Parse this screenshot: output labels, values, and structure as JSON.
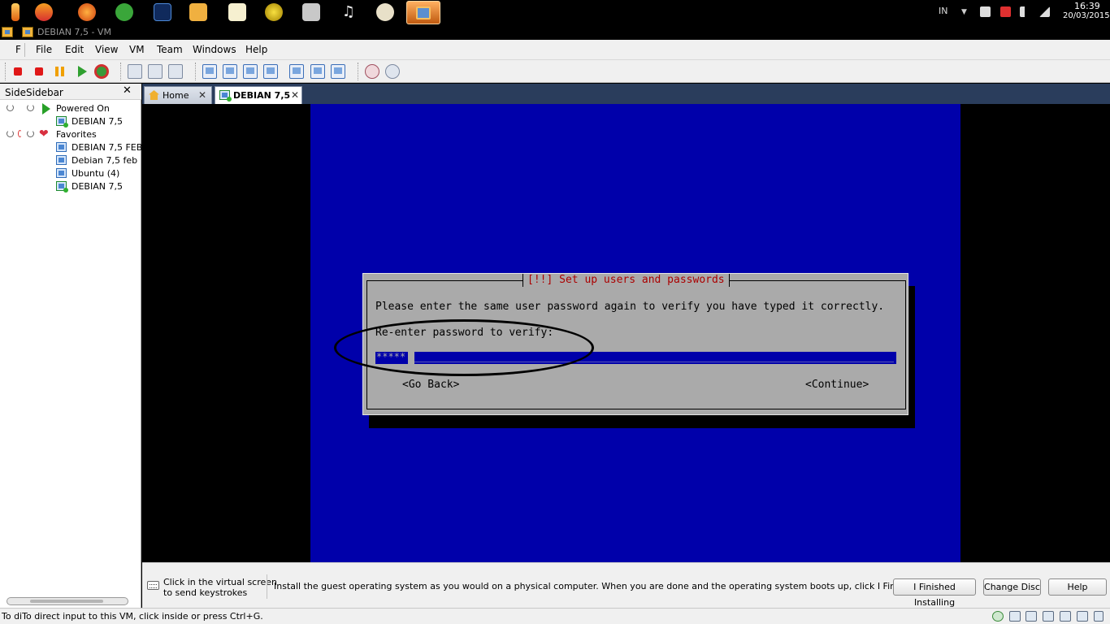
{
  "taskbar": {
    "icons": [
      "candle-icon",
      "apple-icon",
      "firefox-icon",
      "green-app-icon",
      "photoshop-icon",
      "vmware-icon",
      "notepad-icon",
      "globe-icon",
      "bank-icon",
      "music-icon",
      "paint-icon",
      "vmware-active-icon"
    ],
    "tray_lang": "IN",
    "clock_time": "16:39",
    "clock_date": "20/03/2015"
  },
  "window": {
    "title": "DEBIAN 7,5 - VM"
  },
  "menubar": {
    "first": "F",
    "items": [
      "File",
      "Edit",
      "View",
      "VM",
      "Team",
      "Windows",
      "Help"
    ]
  },
  "sidebar": {
    "tab": "Side",
    "title": "Sidebar",
    "close": "✕",
    "tree": [
      {
        "label": "Powered On",
        "type": "group-powered"
      },
      {
        "label": "DEBIAN 7,5",
        "type": "vm-on"
      },
      {
        "label": "Favorites",
        "type": "group-favorites"
      },
      {
        "label": "DEBIAN 7,5 FEB",
        "type": "vm"
      },
      {
        "label": "Debian 7,5 feb",
        "type": "vm"
      },
      {
        "label": "Ubuntu (4)",
        "type": "vm"
      },
      {
        "label": "DEBIAN 7,5",
        "type": "vm-on"
      }
    ]
  },
  "tabs": [
    {
      "label": "Home",
      "close": "✕"
    },
    {
      "label": "DEBIAN 7,5",
      "close": "✕"
    }
  ],
  "installer": {
    "title": "[!!] Set up users and passwords",
    "message": "Please enter the same user password again to verify you have typed it correctly.",
    "prompt": "Re-enter password to verify:",
    "password_value": "*****",
    "go_back": "<Go Back>",
    "continue": "<Continue>"
  },
  "hint": {
    "click_line1": "Click in the virtual screen",
    "click_line2": "to send keystrokes",
    "message": "Install the guest operating system as you would on a physical computer. When you are done and the operating system boots up, click I Finished Installing.",
    "btn_finished": "I Finished Installing",
    "btn_change_disc": "Change Disc",
    "btn_help": "Help"
  },
  "status": {
    "text": "To diTo direct input to this VM, click inside or press Ctrl+G."
  },
  "colors": {
    "installer_blue": "#0000aa",
    "installer_gray": "#aaaaaa",
    "title_red": "#aa0000"
  }
}
